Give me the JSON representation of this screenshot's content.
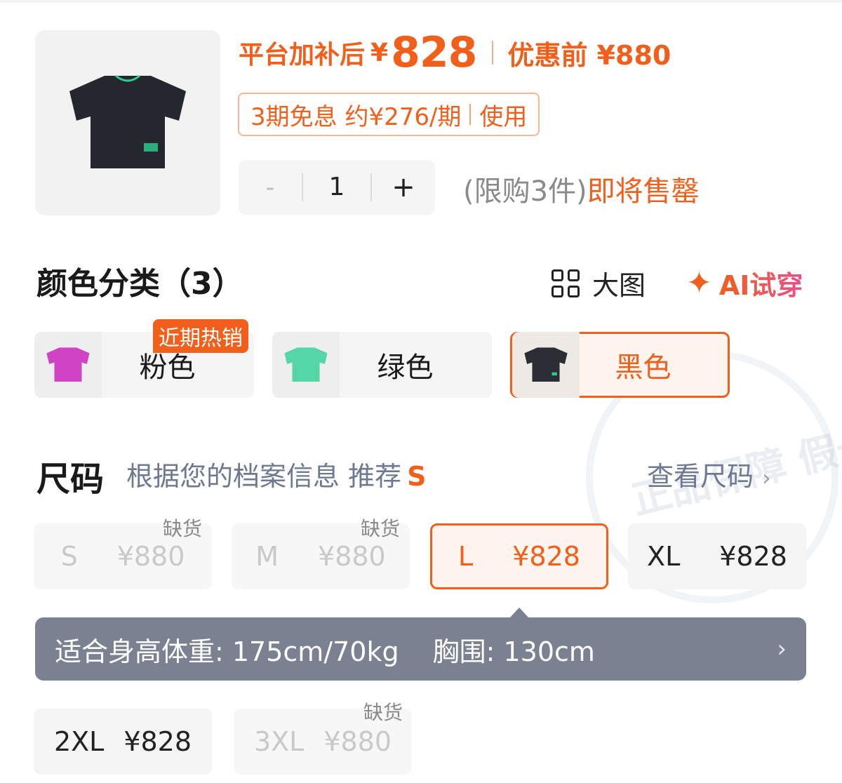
{
  "product": {
    "price_label": "平台加补后",
    "price_currency": "¥",
    "price_value": "828",
    "original_label": "优惠前 ¥880",
    "installment_text": "3期免息 约¥276/期",
    "installment_action": "使用",
    "quantity": {
      "minus": "-",
      "value": "1",
      "plus": "+"
    },
    "limit_text": "(限购3件)",
    "stock_status": "即将售罄"
  },
  "colors": {
    "title": "颜色分类（3）",
    "view_large_label": "大图",
    "ai_try_label": "AI试穿",
    "hot_badge": "近期热销",
    "options": [
      {
        "name": "粉色",
        "swatch": "#d044c4",
        "selected": false
      },
      {
        "name": "绿色",
        "swatch": "#55d6a6",
        "selected": false
      },
      {
        "name": "黑色",
        "swatch": "#2a2d33",
        "selected": true
      }
    ]
  },
  "sizes": {
    "title": "尺码",
    "recommend_prefix": "根据您的档案信息 推荐",
    "recommend_value": "S",
    "chart_link": "查看尺码",
    "out_of_stock_label": "缺货",
    "options": [
      {
        "size": "S",
        "price": "¥880",
        "state": "out_of_stock"
      },
      {
        "size": "M",
        "price": "¥880",
        "state": "out_of_stock"
      },
      {
        "size": "L",
        "price": "¥828",
        "state": "selected"
      },
      {
        "size": "XL",
        "price": "¥828",
        "state": "available"
      },
      {
        "size": "2XL",
        "price": "¥828",
        "state": "available"
      },
      {
        "size": "3XL",
        "price": "¥880",
        "state": "out_of_stock"
      }
    ],
    "fit_tip": {
      "body": "适合身高体重: 175cm/70kg",
      "chest": "胸围: 130cm"
    }
  },
  "watermark": "正品保障 假一赔"
}
